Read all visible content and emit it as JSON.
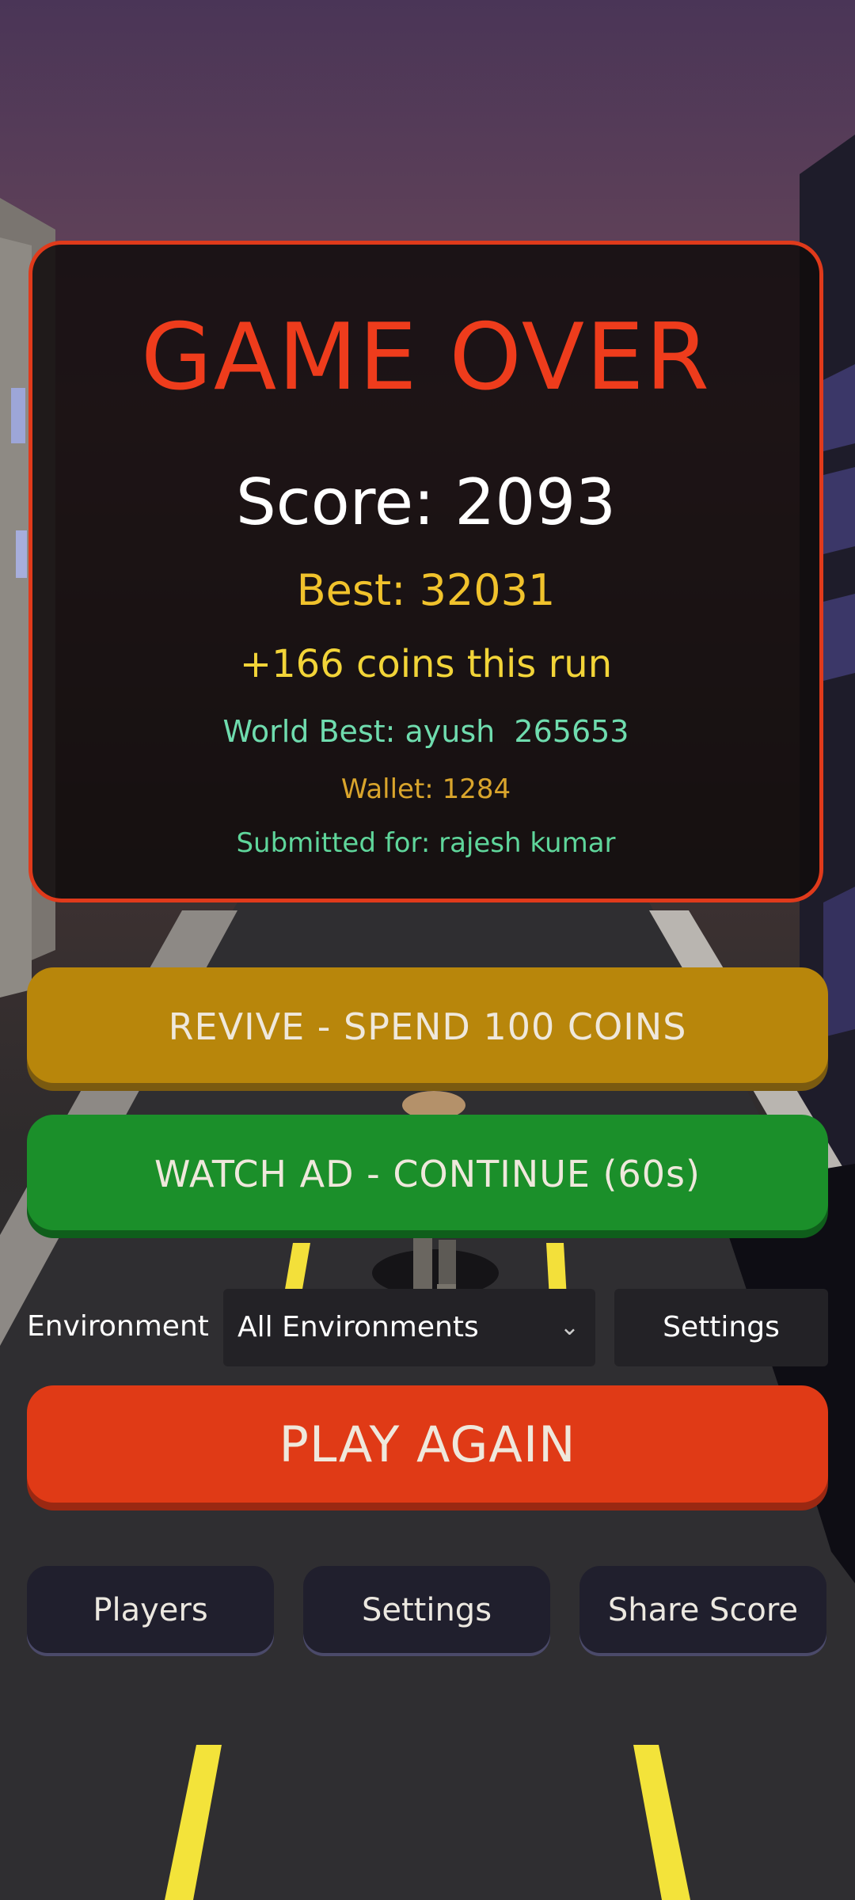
{
  "game_over": {
    "title": "GAME OVER",
    "score": "Score: 2093",
    "best": "Best: 32031",
    "coins_run": "+166 coins this run",
    "world_best": "World Best: ayush  265653",
    "wallet": "Wallet: 1284",
    "submitted": "Submitted for: rajesh kumar"
  },
  "actions": {
    "revive_label": "REVIVE - SPEND 100 COINS",
    "watch_ad_label": "WATCH AD - CONTINUE (60s)",
    "play_again_label": "PLAY AGAIN"
  },
  "environment": {
    "label": "Environment",
    "selected": "All Environments",
    "settings_label": "Settings"
  },
  "bottom_buttons": {
    "players": "Players",
    "settings": "Settings",
    "share": "Share Score"
  },
  "colors": {
    "accent_red": "#e03a1b",
    "revive_gold": "#b8860b",
    "watch_green": "#1b8f2a",
    "play_red": "#e03a16",
    "best_yellow": "#f0c22c",
    "world_green": "#6fdcae"
  }
}
